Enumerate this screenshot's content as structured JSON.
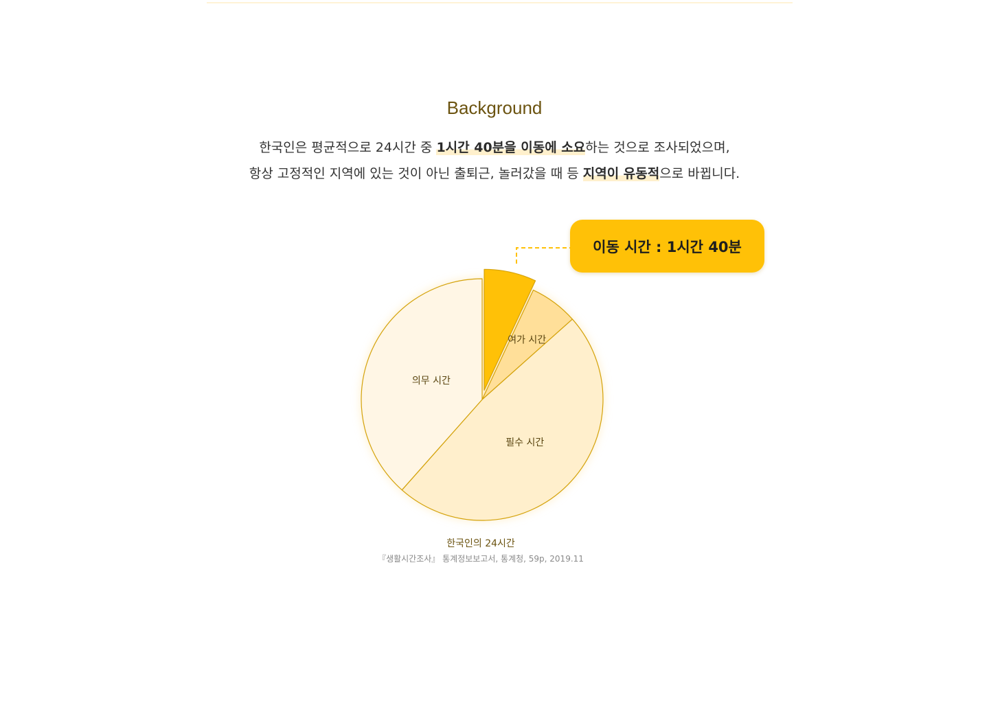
{
  "section": {
    "title": "Background"
  },
  "description": {
    "line1_pre": "한국인은 평균적으로 24시간 중 ",
    "line1_highlight": "1시간 40분을 이동에 소요",
    "line1_post": "하는 것으로 조사되었으며,",
    "line2_pre": "항상 고정적인 지역에 있는 것이 아닌 출퇴근, 놀러갔을 때 등 ",
    "line2_highlight": "지역이 유동적",
    "line2_post": "으로 바뀝니다."
  },
  "callout": {
    "text": "이동 시간 : 1시간 40분"
  },
  "caption": {
    "title": "한국인의 24시간",
    "source": "『생활시간조사』 통계정보보고서, 통계청, 59p, 2019.11"
  },
  "colors": {
    "accent": "#ffc107",
    "title": "#6b5310",
    "slice_border": "#d4a20a",
    "essential": "#ffefcc",
    "obligatory": "#fff6e5",
    "leisure": "#ffdf99",
    "travel": "#ffc107"
  },
  "chart_data": {
    "type": "pie",
    "slices": [
      {
        "label": "",
        "value": 1.67,
        "exploded": true
      },
      {
        "label": "여가 시간",
        "value": 1.55
      },
      {
        "label": "필수 시간",
        "value": 11.55
      },
      {
        "label": "의무 시간",
        "value": 9.23
      }
    ]
  }
}
